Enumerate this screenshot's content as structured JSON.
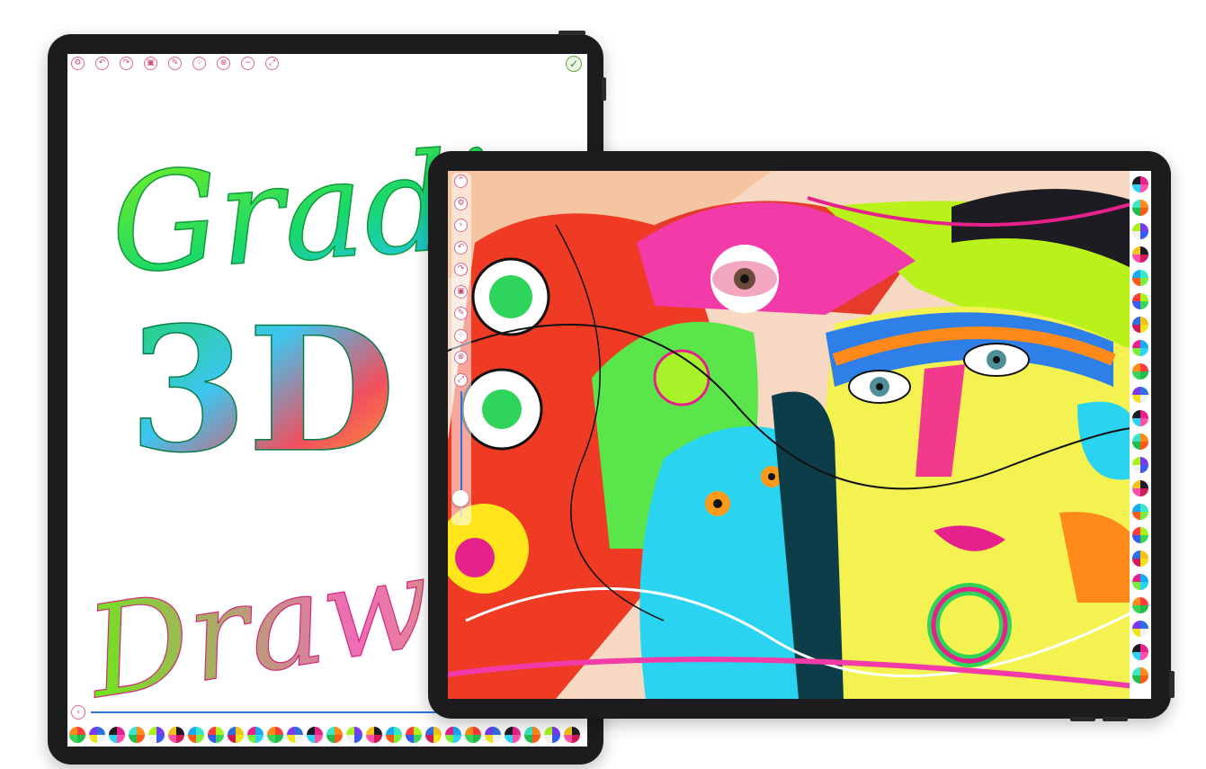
{
  "left_tablet": {
    "toolbar": [
      {
        "name": "settings-button",
        "icon": "gear-icon",
        "glyph": "⚙"
      },
      {
        "name": "undo-button",
        "icon": "undo-icon",
        "glyph": "↶"
      },
      {
        "name": "redo-button",
        "icon": "redo-icon",
        "glyph": "↷"
      },
      {
        "name": "image-button",
        "icon": "image-icon",
        "glyph": "▣"
      },
      {
        "name": "brush-button",
        "icon": "brush-icon",
        "glyph": "✎"
      },
      {
        "name": "palette-button",
        "icon": "palette-icon",
        "glyph": "⁘"
      },
      {
        "name": "clear-button",
        "icon": "clear-icon",
        "glyph": "⊗"
      },
      {
        "name": "minus-button",
        "icon": "minus-icon",
        "glyph": "−"
      },
      {
        "name": "fullscreen-button",
        "icon": "expand-icon",
        "glyph": "⤢"
      }
    ],
    "done_glyph": "✓",
    "back_glyph": "‹",
    "canvas_text": {
      "line1": "Gradient",
      "line2": "3D",
      "line3": "Drawing"
    },
    "palette_count": 26
  },
  "right_tablet": {
    "toolbar": [
      {
        "name": "collapse-button",
        "icon": "chevron-up-icon",
        "glyph": "⌃"
      },
      {
        "name": "settings-button",
        "icon": "gear-icon",
        "glyph": "⚙"
      },
      {
        "name": "forward-button",
        "icon": "chevron-right-icon",
        "glyph": "›"
      },
      {
        "name": "undo-button",
        "icon": "undo-icon",
        "glyph": "↶"
      },
      {
        "name": "redo-button",
        "icon": "redo-icon",
        "glyph": "↷"
      },
      {
        "name": "image-button",
        "icon": "image-icon",
        "glyph": "▣"
      },
      {
        "name": "brush-button",
        "icon": "brush-icon",
        "glyph": "✎"
      },
      {
        "name": "palette-button",
        "icon": "palette-icon",
        "glyph": "⁘"
      },
      {
        "name": "clear-button",
        "icon": "clear-icon",
        "glyph": "⊗"
      },
      {
        "name": "fullscreen-button",
        "icon": "expand-icon",
        "glyph": "⤢"
      }
    ],
    "brush_size_slider": 0.15,
    "palette_count": 22
  },
  "colors": {
    "device": "#1c1c1e",
    "accent": "#d9688a",
    "slider": "#2f6fe0"
  }
}
